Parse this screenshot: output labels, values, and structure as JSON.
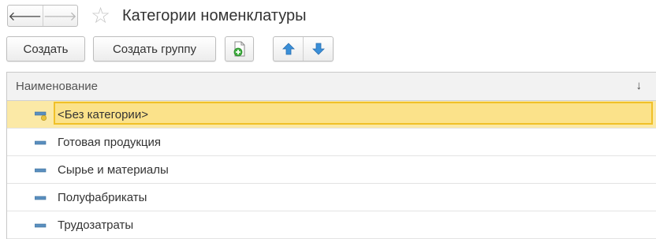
{
  "window": {
    "title": "Категории номенклатуры",
    "nav": {
      "back_icon": "arrow-left-icon",
      "forward_icon": "arrow-right-icon"
    },
    "favorite_icon": "star-icon"
  },
  "toolbar": {
    "create_label": "Создать",
    "create_group_label": "Создать группу",
    "copy_icon": "copy-document-icon",
    "move_up_icon": "arrow-up-icon",
    "move_down_icon": "arrow-down-icon"
  },
  "table": {
    "columns": [
      {
        "label": "Наименование",
        "sort_indicator": "↓"
      }
    ],
    "rows": [
      {
        "label": "<Без категории>",
        "selected": true,
        "icon": "predefined-item-icon"
      },
      {
        "label": "Готовая продукция",
        "selected": false,
        "icon": "item-icon"
      },
      {
        "label": "Сырье и материалы",
        "selected": false,
        "icon": "item-icon"
      },
      {
        "label": "Полуфабрикаты",
        "selected": false,
        "icon": "item-icon"
      },
      {
        "label": "Трудозатраты",
        "selected": false,
        "icon": "item-icon"
      }
    ]
  },
  "colors": {
    "selection": "#fbe9a6",
    "selection_border": "#f0c028",
    "arrow_blue": "#3a8fd8"
  }
}
